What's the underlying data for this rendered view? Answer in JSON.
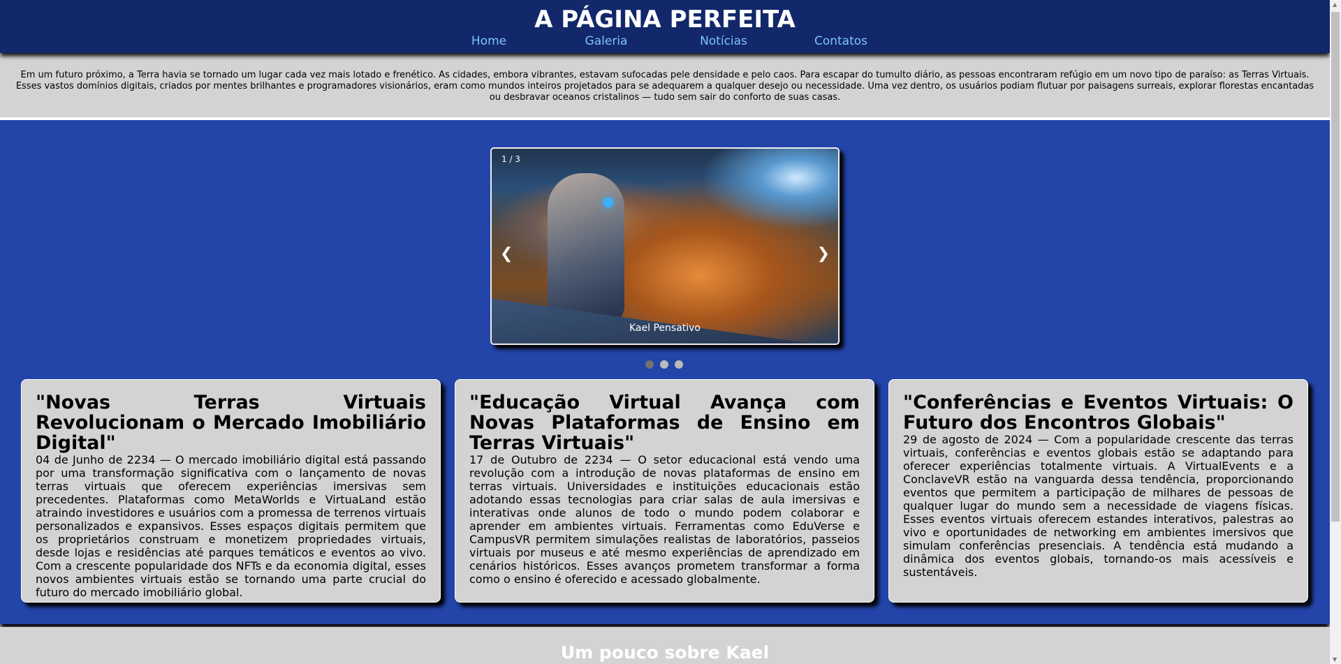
{
  "header": {
    "title": "A PÁGINA PERFEITA",
    "nav": [
      "Home",
      "Galeria",
      "Notícias",
      "Contatos"
    ]
  },
  "intro": "Em um futuro próximo, a Terra havia se tornado um lugar cada vez mais lotado e frenético. As cidades, embora vibrantes, estavam sufocadas pele densidade e pelo caos. Para escapar do tumulto diário, as pessoas encontraram refúgio em um novo tipo de paraíso: as Terras Virtuais. Esses vastos domínios digitais, criados por mentes brilhantes e programadores visionários, eram como mundos inteiros projetados para se adequarem a qualquer desejo ou necessidade. Uma vez dentro, os usuários podiam flutuar por paisagens surreais, explorar florestas encantadas ou desbravar oceanos cristalinos — tudo sem sair do conforto de suas casas.",
  "carousel": {
    "counter": "1 / 3",
    "caption": "Kael Pensativo",
    "prev": "❮",
    "next": "❯",
    "slides": 3,
    "active": 1
  },
  "cards": [
    {
      "title": "\"Novas Terras Virtuais Revolucionam o Mercado Imobiliário Digital\"",
      "body": "04 de Junho de 2234 — O mercado imobiliário digital está passando por uma transformação significativa com o lançamento de novas terras virtuais que oferecem experiências imersivas sem precedentes. Plataformas como MetaWorlds e VirtuaLand estão atraindo investidores e usuários com a promessa de terrenos virtuais personalizados e expansivos. Esses espaços digitais permitem que os proprietários construam e monetizem propriedades virtuais, desde lojas e residências até parques temáticos e eventos ao vivo. Com a crescente popularidade dos NFTs e da economia digital, esses novos ambientes virtuais estão se tornando uma parte crucial do futuro do mercado imobiliário global."
    },
    {
      "title": "\"Educação Virtual Avança com Novas Plataformas de Ensino em Terras Virtuais\"",
      "body": "17 de Outubro de 2234 — O setor educacional está vendo uma revolução com a introdução de novas plataformas de ensino em terras virtuais. Universidades e instituições educacionais estão adotando essas tecnologias para criar salas de aula imersivas e interativas onde alunos de todo o mundo podem colaborar e aprender em ambientes virtuais. Ferramentas como EduVerse e CampusVR permitem simulações realistas de laboratórios, passeios virtuais por museus e até mesmo experiências de aprendizado em cenários históricos. Esses avanços prometem transformar a forma como o ensino é oferecido e acessado globalmente."
    },
    {
      "title": "\"Conferências e Eventos Virtuais: O Futuro dos Encontros Globais\"",
      "body": "29 de agosto de 2024 — Com a popularidade crescente das terras virtuais, conferências e eventos globais estão se adaptando para oferecer experiências totalmente virtuais. A VirtualEvents e a ConclaveVR estão na vanguarda dessa tendência, proporcionando eventos que permitem a participação de milhares de pessoas de qualquer lugar do mundo sem a necessidade de viagens físicas. Esses eventos virtuais oferecem estandes interativos, palestras ao vivo e oportunidades de networking em ambientes imersivos que simulam conferências presenciais. A tendência está mudando a dinâmica dos eventos globais, tornando-os mais acessíveis e sustentáveis."
    }
  ],
  "about": {
    "title": "Um pouco sobre Kael"
  },
  "colors": {
    "header": "#12286b",
    "nav_link": "#7ec3ff",
    "section": "#2344a9",
    "panel": "#d3d3d3"
  }
}
